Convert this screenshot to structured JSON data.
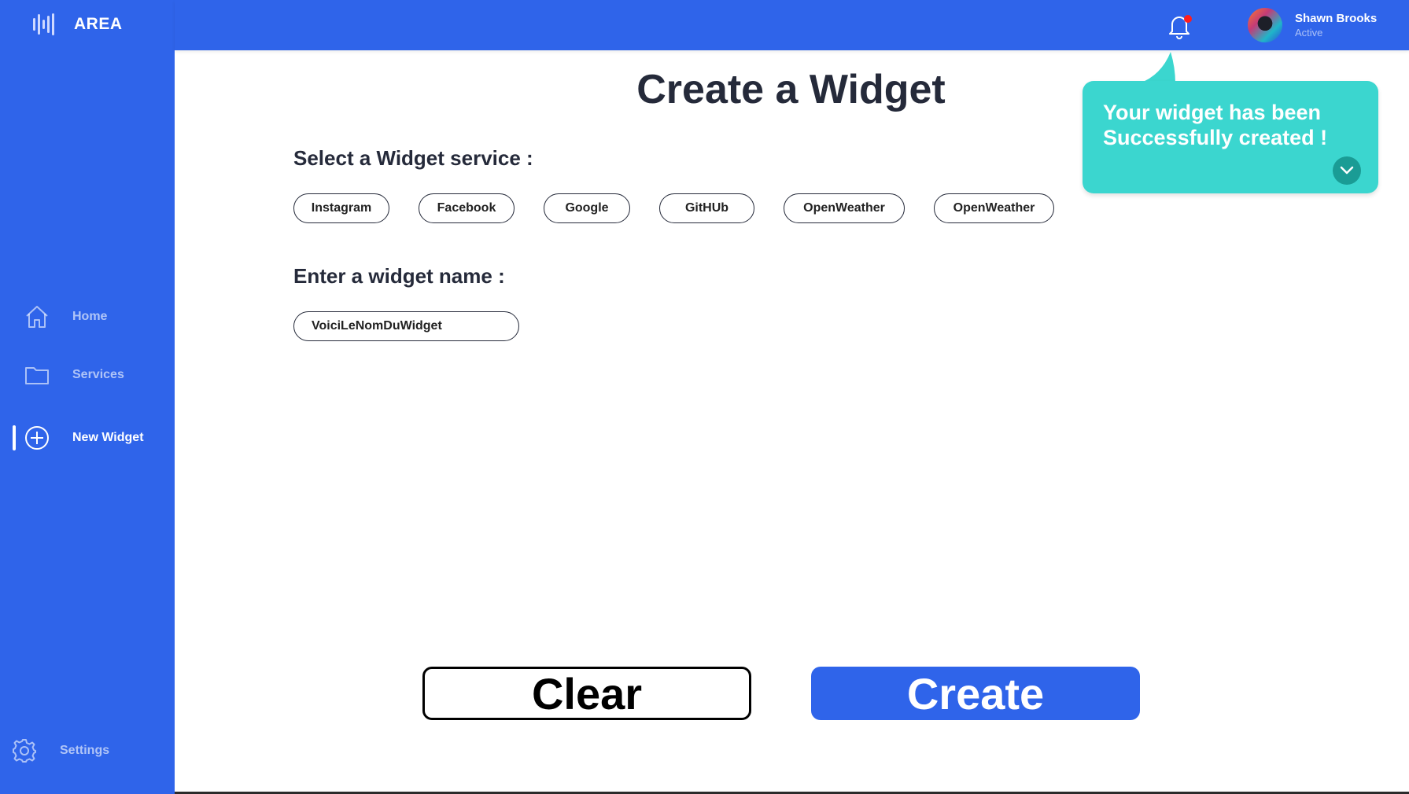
{
  "brand": {
    "name": "AREA"
  },
  "sidebar": {
    "items": [
      {
        "label": "Home",
        "icon": "home-icon"
      },
      {
        "label": "Services",
        "icon": "folder-icon"
      },
      {
        "label": "New Widget",
        "icon": "plus-circle-icon",
        "active": true
      }
    ],
    "settings_label": "Settings"
  },
  "header": {
    "user_name": "Shawn Brooks",
    "user_status": "Active",
    "notification_dot": true
  },
  "main": {
    "title": "Create a Widget",
    "service_label": "Select a Widget service :",
    "services": [
      "Instagram",
      "Facebook",
      "Google",
      "GitHUb",
      "OpenWeather",
      "OpenWeather"
    ],
    "name_label": "Enter a widget name :",
    "name_value": "VoiciLeNomDuWidget",
    "clear_label": "Clear",
    "create_label": "Create"
  },
  "toast": {
    "message": "Your widget has been Successfully created !"
  },
  "colors": {
    "primary": "#2f64ea",
    "toast": "#3bd6cf",
    "toast_dark": "#1a9c95",
    "text": "#252a3a",
    "notification": "#ff1d1d"
  }
}
